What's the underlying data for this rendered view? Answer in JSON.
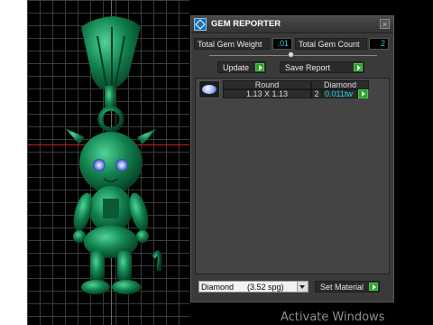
{
  "panel": {
    "title": "GEM REPORTER",
    "close_glyph": "×",
    "total_weight_label": "Total Gem Weight",
    "total_weight_value": ".01",
    "total_count_label": "Total Gem Count",
    "total_count_value": "2",
    "update_label": "Update",
    "save_report_label": "Save Report"
  },
  "gem_table": {
    "columns": [
      "Round",
      "Diamond"
    ],
    "rows": [
      {
        "size": "1.13 X 1.13",
        "count": "2",
        "carat": "0.011tw"
      }
    ]
  },
  "material": {
    "selected": "Diamond      (3.52 spg)",
    "set_label": "Set Material"
  },
  "watermark": "Activate Windows",
  "colors": {
    "model": "#0f7a4a",
    "grid": "#3a3a3a",
    "axis": "#d11a1a",
    "value_text": "#1fd5e6",
    "go_button": "#26a326"
  },
  "icons": [
    "gem-reporter-logo-icon",
    "close-icon",
    "play-arrow-icon",
    "diamond-stone-icon",
    "chevron-down-icon"
  ]
}
